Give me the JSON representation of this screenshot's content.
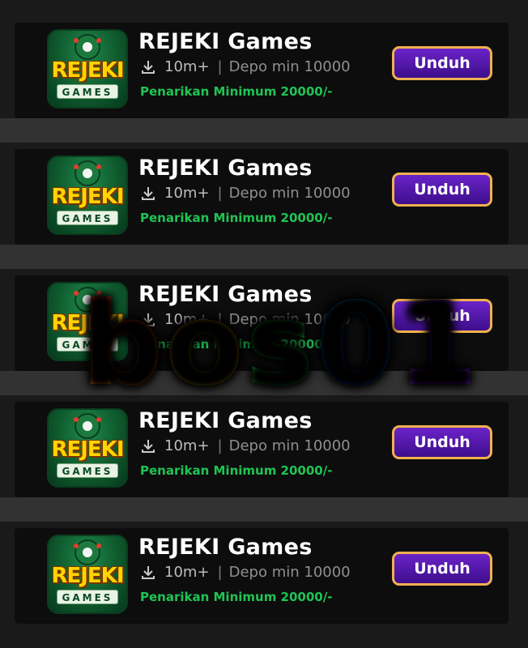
{
  "apps": [
    {
      "title": "REJEKI Games",
      "downloads": "10m+",
      "deposit": "Depo min 10000",
      "promo": "Penarikan Minimum 20000/-",
      "button": "Unduh",
      "icon_word": "REJEKI",
      "icon_sub": "GAMES"
    },
    {
      "title": "REJEKI Games",
      "downloads": "10m+",
      "deposit": "Depo min 10000",
      "promo": "Penarikan Minimum 20000/-",
      "button": "Unduh",
      "icon_word": "REJEKI",
      "icon_sub": "GAMES"
    },
    {
      "title": "REJEKI Games",
      "downloads": "10m+",
      "deposit": "Depo min 10000",
      "promo": "Penarikan Minimum 20000/-",
      "button": "Unduh",
      "icon_word": "REJEKI",
      "icon_sub": "GAMES"
    },
    {
      "title": "REJEKI Games",
      "downloads": "10m+",
      "deposit": "Depo min 10000",
      "promo": "Penarikan Minimum 20000/-",
      "button": "Unduh",
      "icon_word": "REJEKI",
      "icon_sub": "GAMES"
    },
    {
      "title": "REJEKI Games",
      "downloads": "10m+",
      "deposit": "Depo min 10000",
      "promo": "Penarikan Minimum 20000/-",
      "button": "Unduh",
      "icon_word": "REJEKI",
      "icon_sub": "GAMES"
    }
  ],
  "watermark": {
    "parts": [
      "b",
      "o",
      "s",
      "0",
      "1"
    ]
  },
  "icons": {
    "download": "download-icon",
    "app": "rejeki-games-logo-icon"
  },
  "colors": {
    "promo": "#1fc454",
    "button_bg": "#4d1aa8",
    "button_border": "#f0b050",
    "separator": "#323232",
    "card_bg": "#0d0d0d"
  }
}
